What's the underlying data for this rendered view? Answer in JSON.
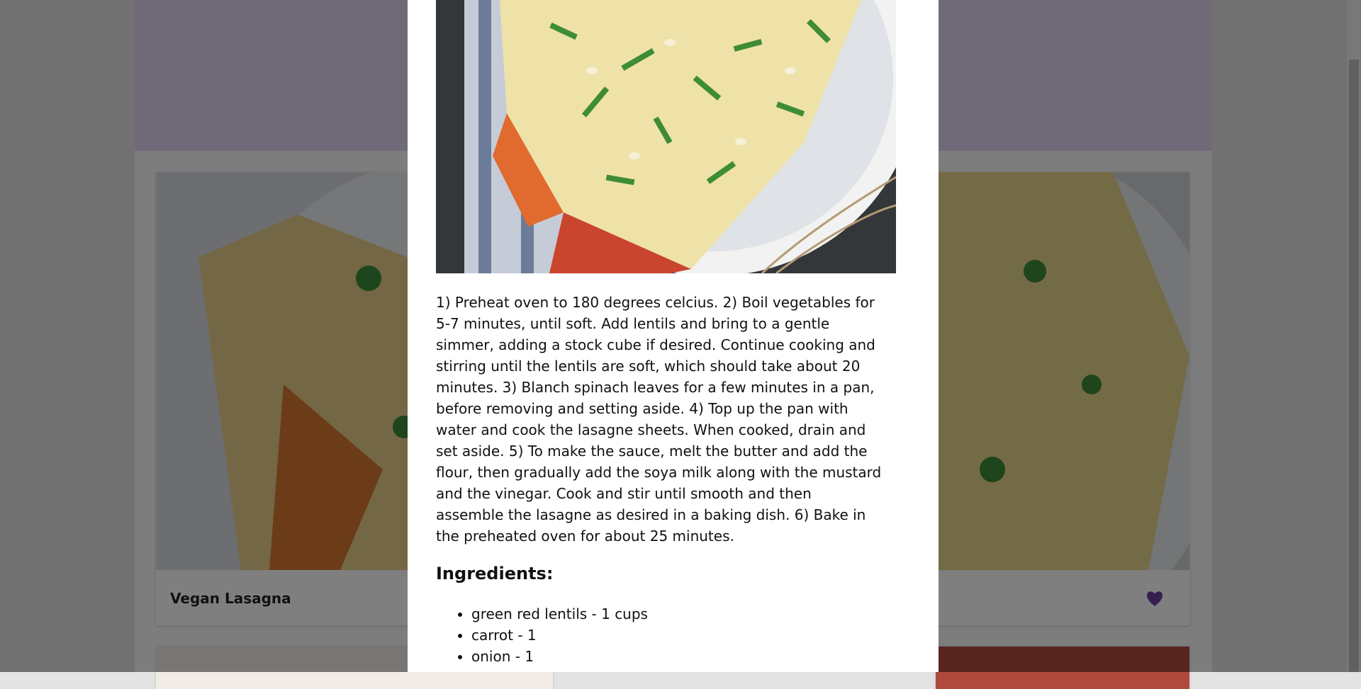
{
  "background": {
    "cards": [
      {
        "title": "Vegan Lasagna"
      }
    ],
    "favorite_icon": "heart-icon",
    "accent_color": "#6d3e9e"
  },
  "modal": {
    "image_alt": "Vegan lasagna on a plate",
    "method": "1) Preheat oven to 180 degrees celcius. 2) Boil vegetables for 5-7 minutes, until soft. Add lentils and bring to a gentle simmer, adding a stock cube if desired. Continue cooking and stirring until the lentils are soft, which should take about 20 minutes. 3) Blanch spinach leaves for a few minutes in a pan, before removing and setting aside. 4) Top up the pan with water and cook the lasagne sheets. When cooked, drain and set aside. 5) To make the sauce, melt the butter and add the flour, then gradually add the soya milk along with the mustard and the vinegar. Cook and stir until smooth and then assemble the lasagne as desired in a baking dish. 6) Bake in the preheated oven for about 25 minutes.",
    "ingredients_title": "Ingredients:",
    "ingredients": [
      "green red lentils - 1 cups",
      "carrot - 1",
      "onion - 1"
    ]
  }
}
